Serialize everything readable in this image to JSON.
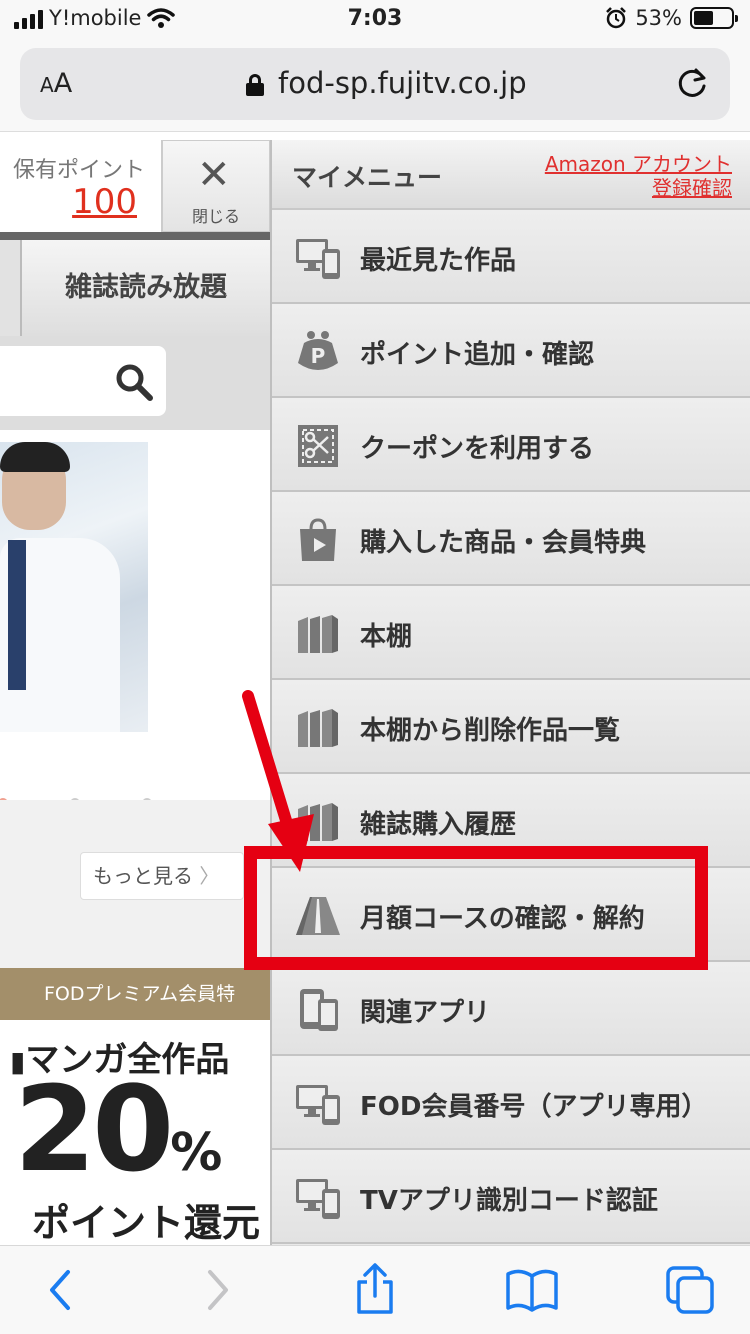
{
  "status": {
    "carrier": "Y!mobile",
    "time": "7:03",
    "battery": "53%",
    "battery_level": 0.53
  },
  "browser": {
    "aa_small": "A",
    "aa_big": "A",
    "url": "fod-sp.fujitv.co.jp"
  },
  "page": {
    "points_label": "保有ポイント",
    "points_value": "100",
    "close_label": "閉じる",
    "tab_magazine": "雑誌読み放題",
    "more_label": "もっと見る",
    "premium_header": "FODプレミアム会員特",
    "promo_line1": "マンガ全作品",
    "promo_big": "20",
    "promo_pct": "%",
    "promo_line3": "ポイント還元"
  },
  "drawer": {
    "title": "マイメニュー",
    "amazon_line1": "Amazon アカウント",
    "amazon_line2": "登録確認",
    "items": [
      {
        "label": "最近見た作品",
        "icon": "devices-icon"
      },
      {
        "label": "ポイント追加・確認",
        "icon": "coin-purse-icon"
      },
      {
        "label": "クーポンを利用する",
        "icon": "coupon-icon"
      },
      {
        "label": "購入した商品・会員特典",
        "icon": "shopping-bag-icon"
      },
      {
        "label": "本棚",
        "icon": "bookshelf-icon"
      },
      {
        "label": "本棚から削除作品一覧",
        "icon": "bookshelf-icon"
      },
      {
        "label": "雑誌購入履歴",
        "icon": "bookshelf-icon"
      },
      {
        "label": "月額コースの確認・解約",
        "icon": "road-icon"
      },
      {
        "label": "関連アプリ",
        "icon": "phones-icon"
      },
      {
        "label": "FOD会員番号（アプリ専用）",
        "icon": "devices-icon"
      },
      {
        "label": "TVアプリ識別コード認証",
        "icon": "devices-icon"
      }
    ]
  },
  "colors": {
    "accent_red": "#e50012",
    "link_red": "#e0302f",
    "ios_blue": "#1a7cf0"
  }
}
